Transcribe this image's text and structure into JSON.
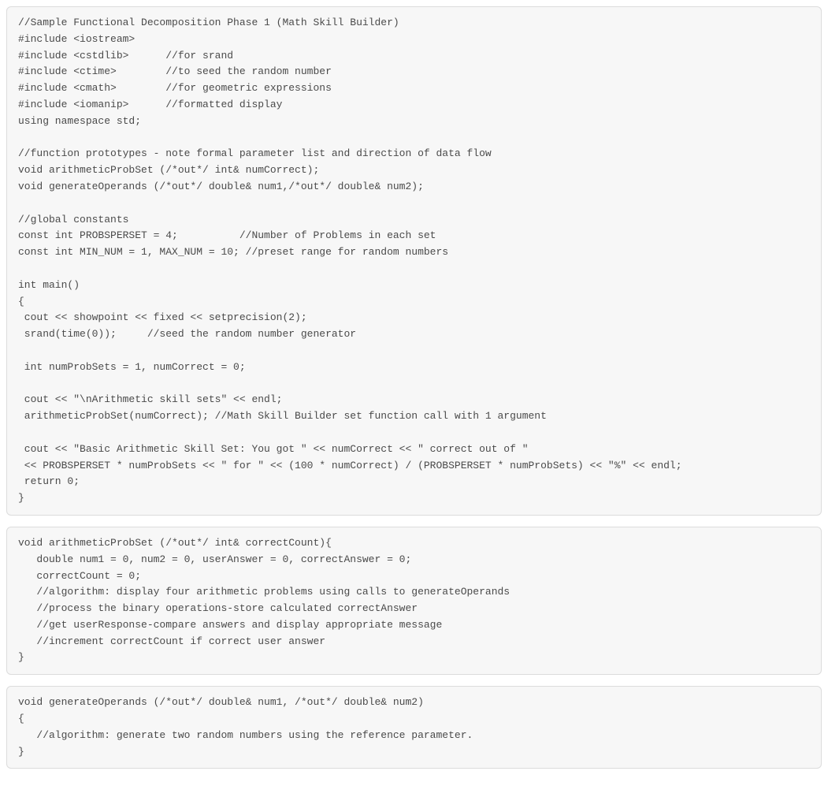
{
  "blocks": [
    {
      "code": "//Sample Functional Decomposition Phase 1 (Math Skill Builder)\n#include <iostream>\n#include <cstdlib>      //for srand\n#include <ctime>        //to seed the random number\n#include <cmath>        //for geometric expressions\n#include <iomanip>      //formatted display\nusing namespace std;\n\n//function prototypes - note formal parameter list and direction of data flow\nvoid arithmeticProbSet (/*out*/ int& numCorrect);\nvoid generateOperands (/*out*/ double& num1,/*out*/ double& num2);\n\n//global constants\nconst int PROBSPERSET = 4;          //Number of Problems in each set\nconst int MIN_NUM = 1, MAX_NUM = 10; //preset range for random numbers\n\nint main()\n{\n cout << showpoint << fixed << setprecision(2);\n srand(time(0));     //seed the random number generator\n\n int numProbSets = 1, numCorrect = 0;\n\n cout << \"\\nArithmetic skill sets\" << endl;\n arithmeticProbSet(numCorrect); //Math Skill Builder set function call with 1 argument\n\n cout << \"Basic Arithmetic Skill Set: You got \" << numCorrect << \" correct out of \"\n << PROBSPERSET * numProbSets << \" for \" << (100 * numCorrect) / (PROBSPERSET * numProbSets) << \"%\" << endl;\n return 0;\n}"
    },
    {
      "code": "void arithmeticProbSet (/*out*/ int& correctCount){\n   double num1 = 0, num2 = 0, userAnswer = 0, correctAnswer = 0;\n   correctCount = 0;\n   //algorithm: display four arithmetic problems using calls to generateOperands\n   //process the binary operations-store calculated correctAnswer\n   //get userResponse-compare answers and display appropriate message\n   //increment correctCount if correct user answer\n}"
    },
    {
      "code": "void generateOperands (/*out*/ double& num1, /*out*/ double& num2)\n{\n   //algorithm: generate two random numbers using the reference parameter.\n}"
    }
  ]
}
